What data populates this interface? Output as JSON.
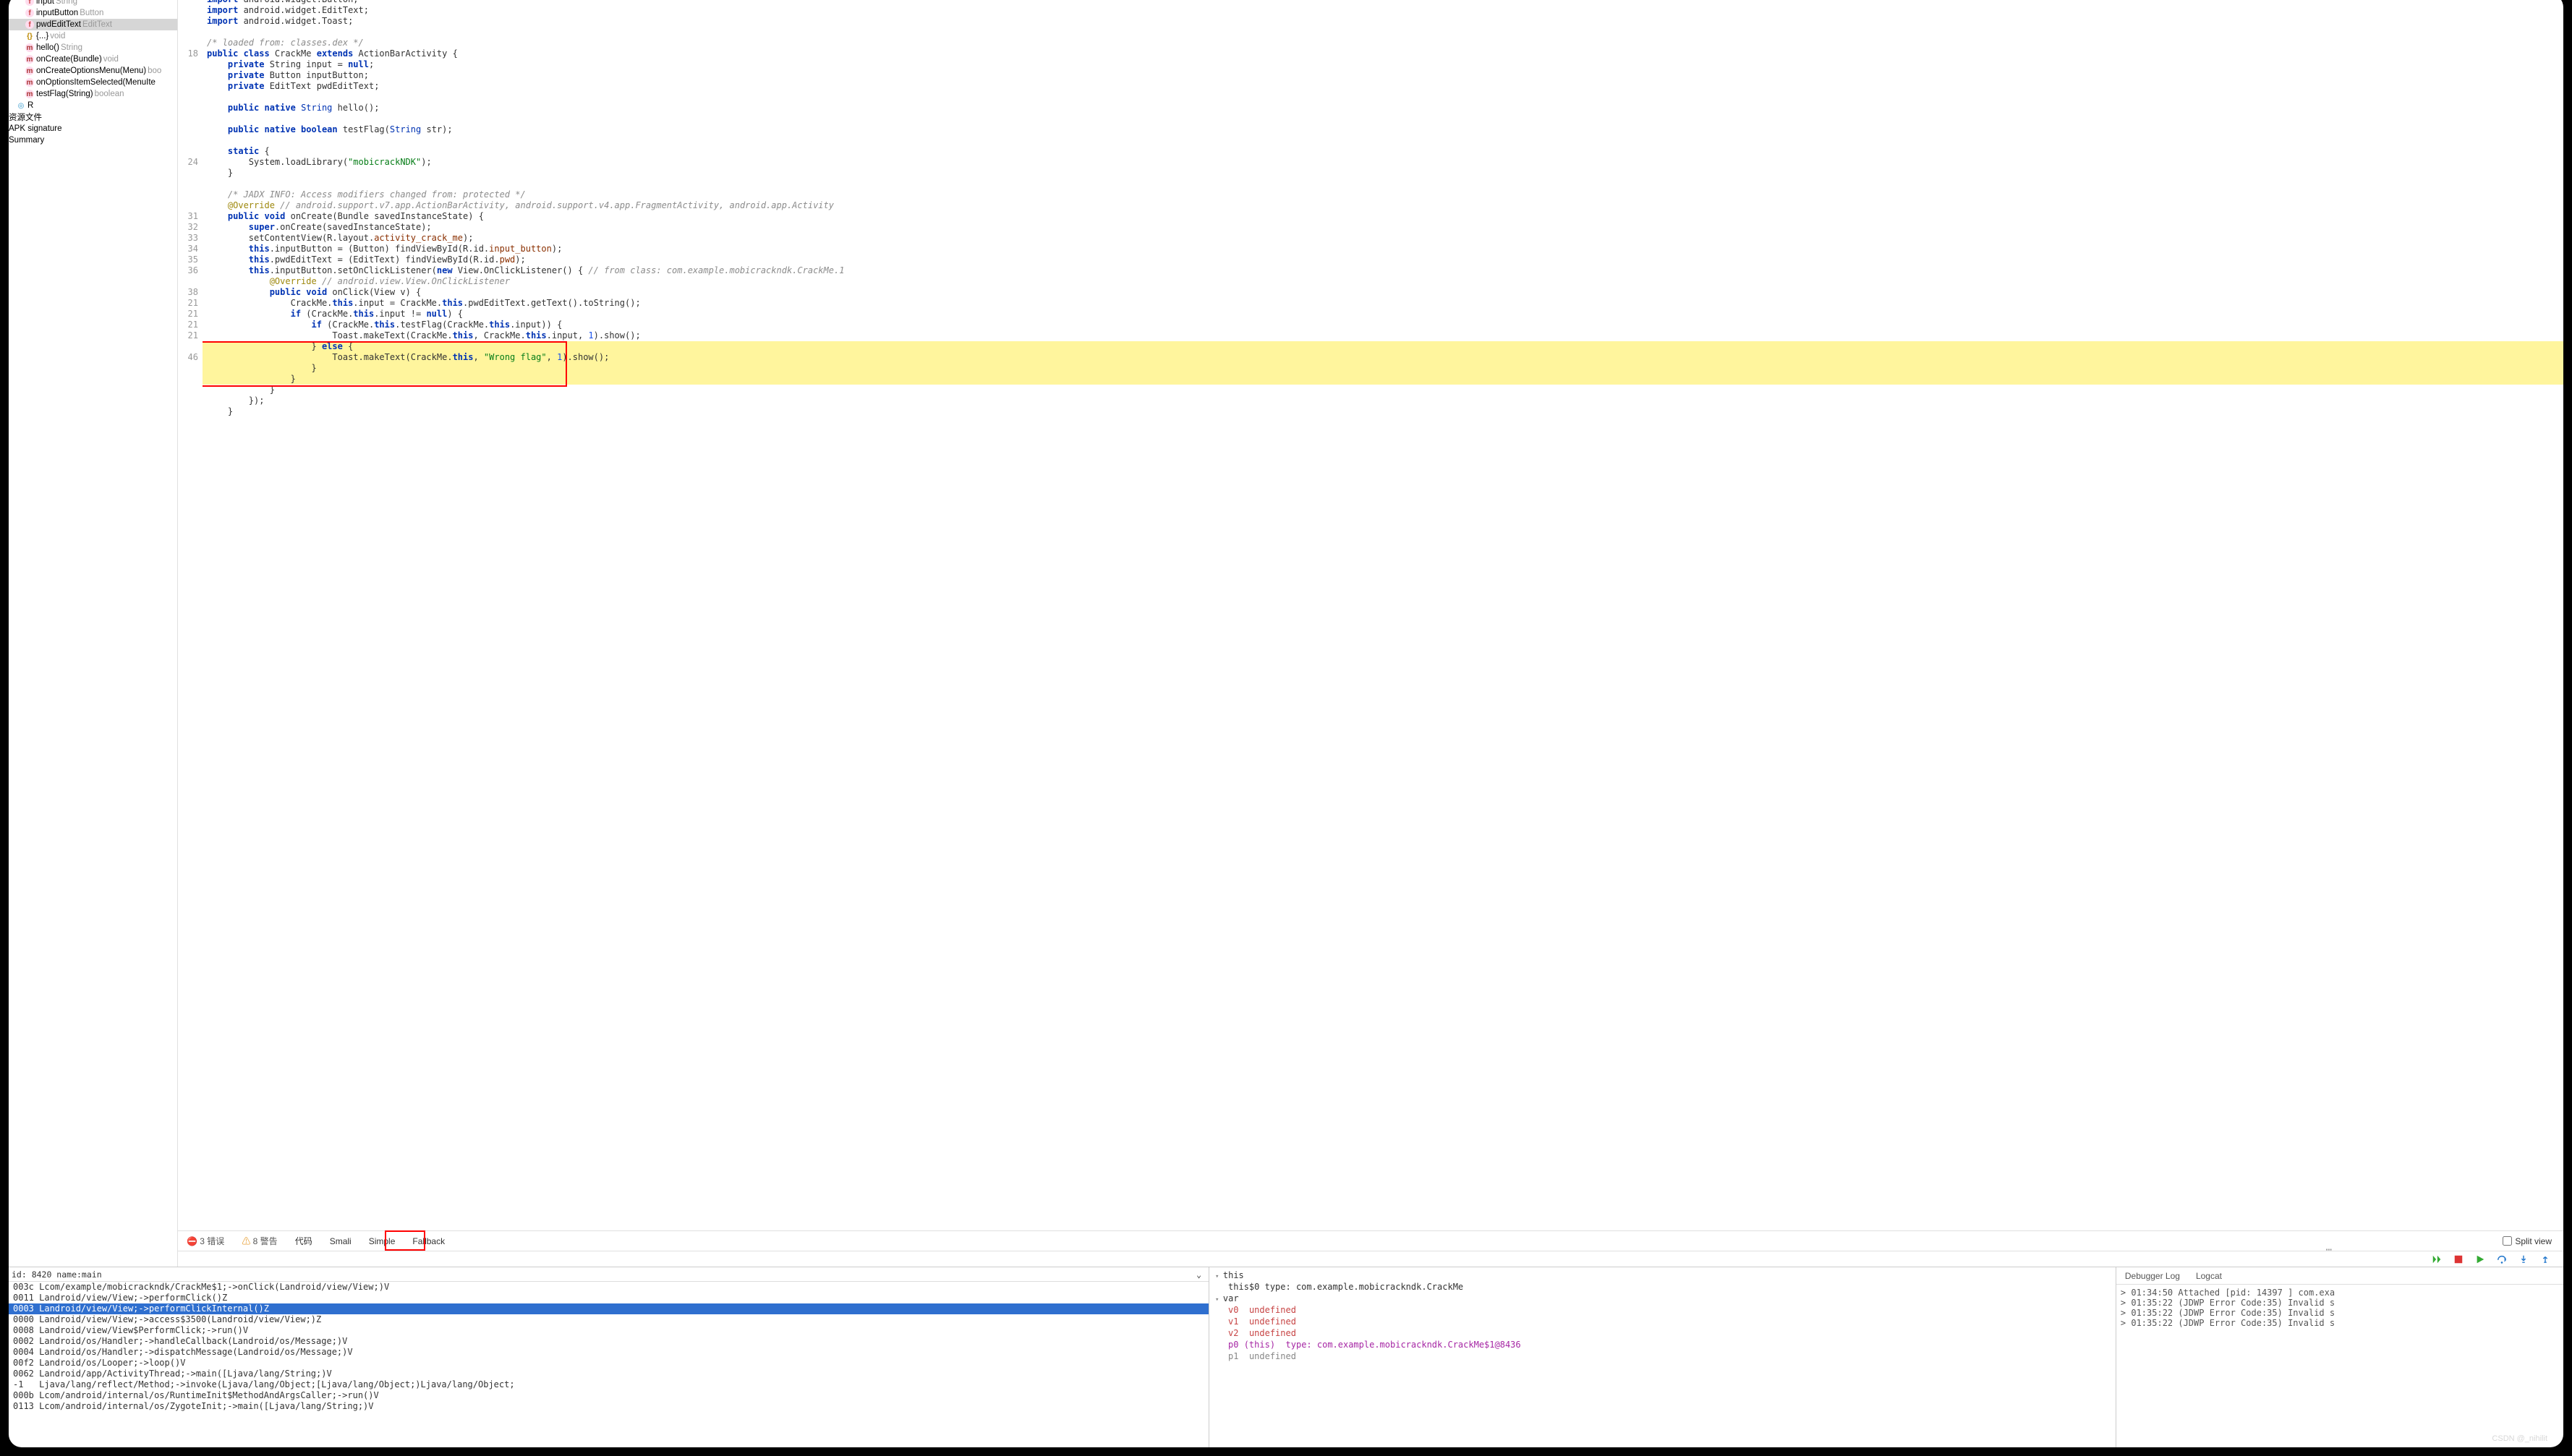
{
  "tree": [
    {
      "icon": "f",
      "indent": 22,
      "name": "input",
      "type": "String"
    },
    {
      "icon": "f",
      "indent": 22,
      "name": "inputButton",
      "type": "Button"
    },
    {
      "icon": "f",
      "indent": 22,
      "name": "pwdEditText",
      "type": "EditText",
      "sel": true
    },
    {
      "icon": "b",
      "indent": 22,
      "name": "{...}",
      "type": "void"
    },
    {
      "icon": "m",
      "indent": 22,
      "name": "hello()",
      "type": "String"
    },
    {
      "icon": "m",
      "indent": 22,
      "name": "onCreate(Bundle)",
      "type": "void"
    },
    {
      "icon": "m",
      "indent": 22,
      "name": "onCreateOptionsMenu(Menu)",
      "type": "boo"
    },
    {
      "icon": "m",
      "indent": 22,
      "name": "onOptionsItemSelected(MenuIte"
    },
    {
      "icon": "m",
      "indent": 22,
      "name": "testFlag(String)",
      "type": "boolean"
    },
    {
      "icon": "c",
      "indent": 10,
      "name": "R"
    },
    {
      "indent": 0,
      "name": "资源文件"
    },
    {
      "indent": 0,
      "name": "APK signature"
    },
    {
      "indent": 0,
      "name": "Summary"
    }
  ],
  "gutter": [
    "",
    "",
    "",
    "",
    "",
    "18",
    "",
    "",
    "",
    "",
    "",
    "",
    "",
    "",
    "",
    "24",
    "",
    "",
    "",
    "",
    "31",
    "32",
    "33",
    "34",
    "35",
    "36",
    "",
    "38",
    "21",
    "21",
    "21",
    "21",
    "",
    "46",
    "",
    "",
    "",
    "",
    ""
  ],
  "code_lines": [
    {
      "h": "<span class=k>import</span> android.widget.Button;"
    },
    {
      "h": "<span class=k>import</span> android.widget.EditText;"
    },
    {
      "h": "<span class=k>import</span> android.widget.Toast;"
    },
    {
      "h": ""
    },
    {
      "h": "<span class=c>/* loaded from: classes.dex */</span>"
    },
    {
      "h": "<span class=k>public class</span> CrackMe <span class=k>extends</span> ActionBarActivity {"
    },
    {
      "h": "    <span class=k>private</span> String input = <span class=k>null</span>;"
    },
    {
      "h": "    <span class=k>private</span> Button inputButton;"
    },
    {
      "h": "    <span class=k>private</span> EditText pwdEditText;"
    },
    {
      "h": ""
    },
    {
      "h": "    <span class=k>public native</span> <span class=t>String</span> <span class=fn>hello</span>();"
    },
    {
      "h": ""
    },
    {
      "h": "    <span class=k>public native boolean</span> <span class=fn>testFlag</span>(<span class=t>String</span> str);"
    },
    {
      "h": ""
    },
    {
      "h": "    <span class=k>static</span> {"
    },
    {
      "h": "        System.loadLibrary(<span class=s>\"mobicrackNDK\"</span>);"
    },
    {
      "h": "    }"
    },
    {
      "h": ""
    },
    {
      "h": "    <span class=c>/* JADX INFO: Access modifiers changed from: protected */</span>"
    },
    {
      "h": "    <span class=a>@Override</span> <span class=c>// android.support.v7.app.ActionBarActivity, android.support.v4.app.FragmentActivity, android.app.Activity</span>"
    },
    {
      "h": "    <span class=k>public void</span> <span class=fn>onCreate</span>(Bundle savedInstanceState) {"
    },
    {
      "h": "        <span class=k>super</span>.onCreate(savedInstanceState);"
    },
    {
      "h": "        setContentView(R.layout.<span class=m>activity_crack_me</span>);"
    },
    {
      "h": "        <span class=k>this</span>.inputButton = (Button) findViewById(R.id.<span class=m>input_button</span>);"
    },
    {
      "h": "        <span class=k>this</span>.pwdEditText = (EditText) findViewById(R.id.<span class=m>pwd</span>);"
    },
    {
      "h": "        <span class=k>this</span>.inputButton.setOnClickListener(<span class=k>new</span> View.OnClickListener() { <span class=c>// from class: com.example.mobicrackndk.CrackMe.1</span>"
    },
    {
      "h": "            <span class=a>@Override</span> <span class=c>// android.view.View.OnClickListener</span>"
    },
    {
      "h": "            <span class=k>public void</span> <span class=fn>onClick</span>(View v) {"
    },
    {
      "h": "                CrackMe.<span class=k>this</span>.input = CrackMe.<span class=k>this</span>.pwdEditText.getText().toString();"
    },
    {
      "h": "                <span class=k>if</span> (CrackMe.<span class=k>this</span>.input != <span class=k>null</span>) {"
    },
    {
      "h": "                    <span class=k>if</span> (CrackMe.<span class=k>this</span>.testFlag(CrackMe.<span class=k>this</span>.input)) {"
    },
    {
      "h": "                        Toast.makeText(CrackMe.<span class=k>this</span>, CrackMe.<span class=k>this</span>.input, <span class=n>1</span>).show();"
    },
    {
      "h": "                    } <span class=k>else</span> {",
      "cls": "hl-y"
    },
    {
      "h": "                        Toast.makeText(CrackMe.<span class=k>this</span>, <span class=s>\"Wrong flag\"</span>, <span class=n>1</span>).show();",
      "cls": "hl-y"
    },
    {
      "h": "                    }",
      "cls": "hl-y"
    },
    {
      "h": "                }",
      "cls": "hl-y"
    },
    {
      "h": "            }"
    },
    {
      "h": "        });"
    },
    {
      "h": "    }"
    }
  ],
  "status": {
    "errors": "3 错误",
    "warnings": "8 警告"
  },
  "tabs": [
    "代码",
    "Smali",
    "Simple",
    "Fallback"
  ],
  "splitview": "Split view",
  "thread_label": "id: 8420 name:main",
  "stack": [
    {
      "a": "003c",
      "t": "Lcom/example/mobicrackndk/CrackMe$1;->onClick(Landroid/view/View;)V"
    },
    {
      "a": "0011",
      "t": "Landroid/view/View;->performClick()Z"
    },
    {
      "a": "0003",
      "t": "Landroid/view/View;->performClickInternal()Z",
      "sel": true
    },
    {
      "a": "0000",
      "t": "Landroid/view/View;->access$3500(Landroid/view/View;)Z"
    },
    {
      "a": "0008",
      "t": "Landroid/view/View$PerformClick;->run()V"
    },
    {
      "a": "0002",
      "t": "Landroid/os/Handler;->handleCallback(Landroid/os/Message;)V"
    },
    {
      "a": "0004",
      "t": "Landroid/os/Handler;->dispatchMessage(Landroid/os/Message;)V"
    },
    {
      "a": "00f2",
      "t": "Landroid/os/Looper;->loop()V"
    },
    {
      "a": "0062",
      "t": "Landroid/app/ActivityThread;->main([Ljava/lang/String;)V"
    },
    {
      "a": "-1  ",
      "t": "Ljava/lang/reflect/Method;->invoke(Ljava/lang/Object;[Ljava/lang/Object;)Ljava/lang/Object;"
    },
    {
      "a": "000b",
      "t": "Lcom/android/internal/os/RuntimeInit$MethodAndArgsCaller;->run()V"
    },
    {
      "a": "0113",
      "t": "Lcom/android/internal/os/ZygoteInit;->main([Ljava/lang/String;)V"
    }
  ],
  "vars": {
    "this_type": "this$0 type: com.example.mobicrackndk.CrackMe",
    "rows": [
      {
        "k": "v0",
        "v": "undefined",
        "c": "vund"
      },
      {
        "k": "v1",
        "v": "undefined",
        "c": "vund"
      },
      {
        "k": "v2",
        "v": "undefined",
        "c": "vund"
      },
      {
        "k": "p0 (this)",
        "v": "type: com.example.mobicrackndk.CrackMe$1@8436",
        "c": "vkey"
      },
      {
        "k": "p1",
        "v": "undefined",
        "c": "vtyp"
      }
    ]
  },
  "log_tabs": [
    "Debugger Log",
    "Logcat"
  ],
  "logs": [
    "> 01:34:50 Attached [pid: 14397 ] com.exa",
    "> 01:35:22 (JDWP Error Code:35) Invalid s",
    "> 01:35:22 (JDWP Error Code:35) Invalid s",
    "> 01:35:22 (JDWP Error Code:35) Invalid s"
  ],
  "watermark": "CSDN @_nihilit"
}
